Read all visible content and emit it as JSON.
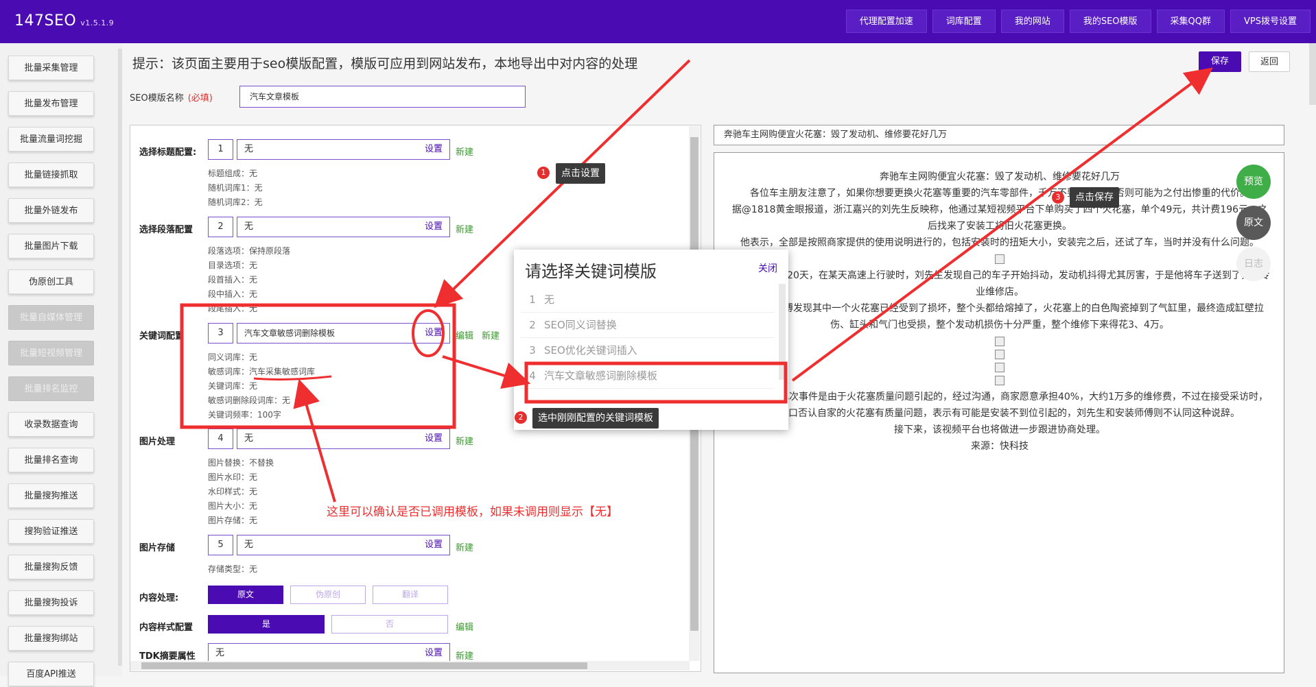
{
  "app": {
    "brand": "147SEO",
    "version": "v1.5.1.9"
  },
  "topnav": [
    "代理配置加速",
    "词库配置",
    "我的网站",
    "我的SEO模版",
    "采集QQ群",
    "VPS拨号设置"
  ],
  "sidebar": [
    {
      "label": "批量采集管理",
      "enabled": true
    },
    {
      "label": "批量发布管理",
      "enabled": true
    },
    {
      "label": "批量流量词挖掘",
      "enabled": true
    },
    {
      "label": "批量链接抓取",
      "enabled": true
    },
    {
      "label": "批量外链发布",
      "enabled": true
    },
    {
      "label": "批量图片下载",
      "enabled": true
    },
    {
      "label": "伪原创工具",
      "enabled": true
    },
    {
      "label": "批量自媒体管理",
      "enabled": false
    },
    {
      "label": "批量短视频管理",
      "enabled": false
    },
    {
      "label": "批量排名监控",
      "enabled": false
    },
    {
      "label": "收录数据查询",
      "enabled": true
    },
    {
      "label": "批量排名查询",
      "enabled": true
    },
    {
      "label": "批量搜狗推送",
      "enabled": true
    },
    {
      "label": "搜狗验证推送",
      "enabled": true
    },
    {
      "label": "批量搜狗反馈",
      "enabled": true
    },
    {
      "label": "批量搜狗投诉",
      "enabled": true
    },
    {
      "label": "批量搜狗绑站",
      "enabled": true
    },
    {
      "label": "百度API推送",
      "enabled": true
    }
  ],
  "header": {
    "tip": "提示：该页面主要用于seo模版配置，模版可应用到网站发布，本地导出中对内容的处理",
    "save": "保存",
    "back": "返回",
    "template_name_label": "SEO模版名称",
    "required": "(必填)",
    "template_name_value": "汽车文章模板"
  },
  "config": {
    "set_label": "设置",
    "new_label": "新建",
    "edit_label": "编辑",
    "title_cfg": {
      "label": "选择标题配置:",
      "num": "1",
      "value": "无",
      "info": [
        "标题组成：无",
        "随机词库1：无",
        "随机词库2：无"
      ]
    },
    "para_cfg": {
      "label": "选择段落配置",
      "num": "2",
      "value": "无",
      "info": [
        "段落选项：保持原段落",
        "目录选项：无",
        "段首插入：无",
        "段中插入：无",
        "段尾插入：无"
      ]
    },
    "kw_cfg": {
      "label": "关键词配置",
      "num": "3",
      "value": "汽车文章敏感词删除模板",
      "info": [
        "同义词库：无",
        "敏感词库：汽车采集敏感词库",
        "关键词库：无",
        "敏感词删除段词库：无",
        "关键词频率：100字"
      ]
    },
    "img_cfg": {
      "label": "图片处理",
      "num": "4",
      "value": "无",
      "info": [
        "图片替换：不替换",
        "图片水印：无",
        "水印样式：无",
        "图片大小：无",
        "图片存储：无"
      ]
    },
    "img_store": {
      "label": "图片存储",
      "num": "5",
      "value": "无",
      "info": [
        "存储类型：无"
      ]
    },
    "content_proc": {
      "label": "内容处理:",
      "options": [
        "原文",
        "伪原创",
        "翻译"
      ]
    },
    "content_style": {
      "label": "内容样式配置",
      "options": [
        "是",
        "否"
      ]
    },
    "tdk": {
      "label": "TDK摘要属性",
      "value": "无"
    }
  },
  "preview": {
    "title": "奔驰车主网购便宜火花塞：毁了发动机、维修要花好几万",
    "lines": [
      "奔驰车主网购便宜火花塞：毁了发动机、维修要花好几万",
      "各位车主朋友注意了，如果你想要更换火花塞等重要的汽车零部件，千万不要贪便宜，否则可能为之付出惨重的代价。",
      "据@1818黄金眼报道，浙江嘉兴的刘先生反映称，他通过某短视频平台下单购买了四个火花塞，单个49元，共计费196元，之后找来了安装工将旧火花塞更换。",
      "他表示，全部是按照商家提供的使用说明进行的，包括安装时的扭矩大小，安装完之后，还试了车，当时并没有什么问题。",
      "但在车子开了20天，在某天高速上行驶时，刘先生发现自己的车子开始抖动，发动机抖得尤其厉害，于是他将车子送到了奔驰专业维修店。",
      "经过维修师傅发现其中一个火花塞已经受到了损坏，整个头都给熔掉了，火花塞上的白色陶瓷掉到了气缸里，最终造成缸壁拉伤、缸头和气门也受损，整个发动机损伤十分严重，整个维修下来得花3、4万。",
      "刘先生认为此次事件是由于火花塞质量问题引起的，经过沟通，商家愿意承担40%，大约1万多的维修费，不过在接受采访时，商家矢口否认自家的火花塞有质量问题，表示有可能是安装不到位引起的，刘先生和安装师傅则不认同这种说辞。",
      "接下来，该视频平台也将做进一步跟进协商处理。",
      "来源：快科技"
    ],
    "float_buttons": [
      "预览",
      "原文",
      "日志"
    ]
  },
  "modal": {
    "title": "请选择关键词模版",
    "close": "关闭",
    "items": [
      {
        "n": "1",
        "label": "无"
      },
      {
        "n": "2",
        "label": "SEO同义词替换"
      },
      {
        "n": "3",
        "label": "SEO优化关键词插入"
      },
      {
        "n": "4",
        "label": "汽车文章敏感词删除模板"
      }
    ]
  },
  "annotations": {
    "step1": {
      "n": "1",
      "text": "点击设置"
    },
    "step2": {
      "n": "2",
      "text": "选中刚刚配置的关键词模板"
    },
    "step3": {
      "n": "3",
      "text": "点击保存"
    },
    "note": "这里可以确认是否已调用模板，如果未调用则显示【无】"
  },
  "colors": {
    "brand": "#4a0bb3",
    "annotation": "#ef2f2f",
    "new_link": "#3a9a2e"
  }
}
